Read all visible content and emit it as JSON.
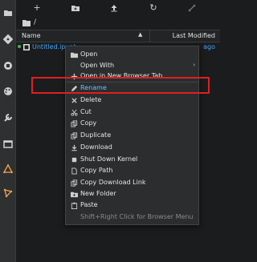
{
  "toolbar": {
    "buttons": [
      {
        "name": "new-launcher-button",
        "glyph": "+"
      },
      {
        "name": "new-folder-button",
        "icon": "folder-plus-icon"
      },
      {
        "name": "upload-button",
        "icon": "upload-icon"
      },
      {
        "name": "refresh-button",
        "glyph": "↻"
      },
      {
        "name": "git-clone-button",
        "icon": "git-clone-icon"
      }
    ]
  },
  "breadcrumb": {
    "path": "/"
  },
  "file_list": {
    "header": {
      "name": "Name",
      "sort_indicator": "▲",
      "last_modified": "Last Modified"
    },
    "rows": [
      {
        "name": "Untitled.ipynb",
        "modified": "ago",
        "running": true
      }
    ]
  },
  "context_menu": {
    "items": [
      {
        "label": "Open",
        "icon": "folder-icon"
      },
      {
        "label": "Open With",
        "icon": "none",
        "submenu": "›"
      },
      {
        "label": "Open in New Browser Tab",
        "icon": "plus-icon"
      },
      {
        "label": "Rename",
        "icon": "pencil-icon",
        "active": true
      },
      {
        "label": "Delete",
        "icon": "close-icon"
      },
      {
        "label": "Cut",
        "icon": "scissors-icon"
      },
      {
        "label": "Copy",
        "icon": "copy-icon"
      },
      {
        "label": "Duplicate",
        "icon": "copy-icon"
      },
      {
        "label": "Download",
        "icon": "download-icon"
      },
      {
        "label": "Shut Down Kernel",
        "icon": "stop-icon"
      },
      {
        "label": "Copy Path",
        "icon": "file-icon"
      },
      {
        "label": "Copy Download Link",
        "icon": "copy-icon"
      },
      {
        "label": "New Folder",
        "icon": "folder-plus-icon"
      },
      {
        "label": "Paste",
        "icon": "paste-icon"
      }
    ],
    "hint": "Shift+Right Click for Browser Menu"
  },
  "colors": {
    "accent_orange": "#f0a64b",
    "link_blue": "#42a5f5",
    "highlight_red": "#e02020",
    "running_green": "#4caf50"
  }
}
